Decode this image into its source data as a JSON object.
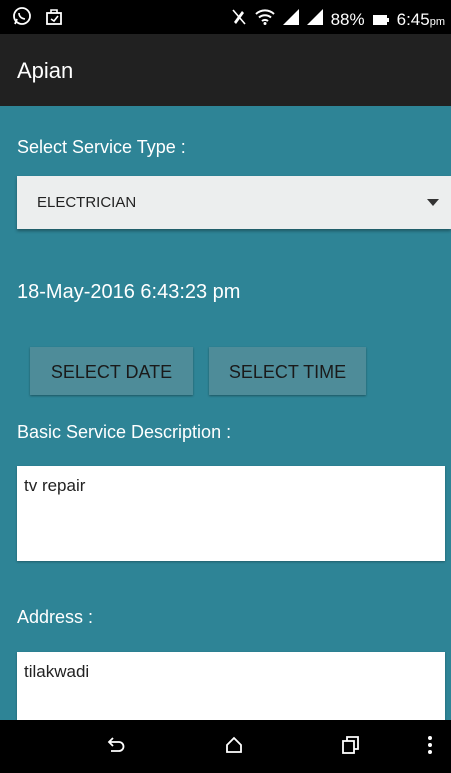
{
  "status_bar": {
    "battery": "88%",
    "time": "6:45",
    "ampm": "pm",
    "icons": [
      "whatsapp-icon",
      "bag-icon",
      "mute-icon",
      "wifi-icon",
      "signal-icon",
      "signal-icon",
      "battery-icon"
    ]
  },
  "action_bar": {
    "title": "Apian"
  },
  "service": {
    "label": "Select Service Type :",
    "selected": "ELECTRICIAN"
  },
  "datetime": {
    "value": "18-May-2016 6:43:23 pm"
  },
  "buttons": {
    "select_date": "SELECT DATE",
    "select_time": "SELECT TIME"
  },
  "description": {
    "label": "Basic Service Description :",
    "value": "tv repair"
  },
  "address": {
    "label": "Address :",
    "value": "tilakwadi"
  },
  "nav": {
    "icons": [
      "back-icon",
      "home-icon",
      "recents-icon",
      "overflow-menu-icon"
    ]
  },
  "colors": {
    "background": "#2e8496",
    "action_bar": "#212121",
    "button": "#4e8c99"
  }
}
